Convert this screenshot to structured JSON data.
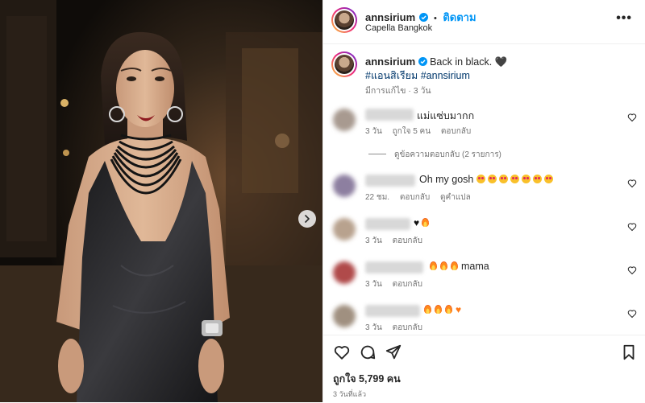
{
  "post": {
    "username": "annsirium",
    "follow_label": "ติดตาม",
    "separator": "•",
    "location": "Capella Bangkok",
    "more_label": "•••",
    "caption_text": "Back in black. ",
    "caption_emoji": "🖤",
    "hashtag_1": "#แอนสิเรียม",
    "hashtag_2": "#annsirium",
    "caption_meta": "มีการแก้ไข · 3 วัน"
  },
  "comments": [
    {
      "text": "แม่แซ่บมากก",
      "time": "3 วัน",
      "likes": "ถูกใจ 5 คน",
      "reply": "ตอบกลับ"
    },
    {
      "text": "Oh my gosh ",
      "time": "22 ชม.",
      "reply": "ตอบกลับ",
      "translate": "ดูคำแปล"
    },
    {
      "text": "",
      "time": "3 วัน",
      "reply": "ตอบกลับ"
    },
    {
      "text": "mama",
      "time": "3 วัน",
      "reply": "ตอบกลับ"
    },
    {
      "text": "",
      "time": "3 วัน",
      "reply": "ตอบกลับ"
    }
  ],
  "view_replies": "ดูข้อความตอบกลับ (2 รายการ)",
  "footer": {
    "likes": "ถูกใจ 5,799 คน",
    "date": "3 วันที่แล้ว"
  },
  "colors": {
    "accent": "#0095f6",
    "hashtag": "#00376b",
    "muted": "#737373"
  }
}
